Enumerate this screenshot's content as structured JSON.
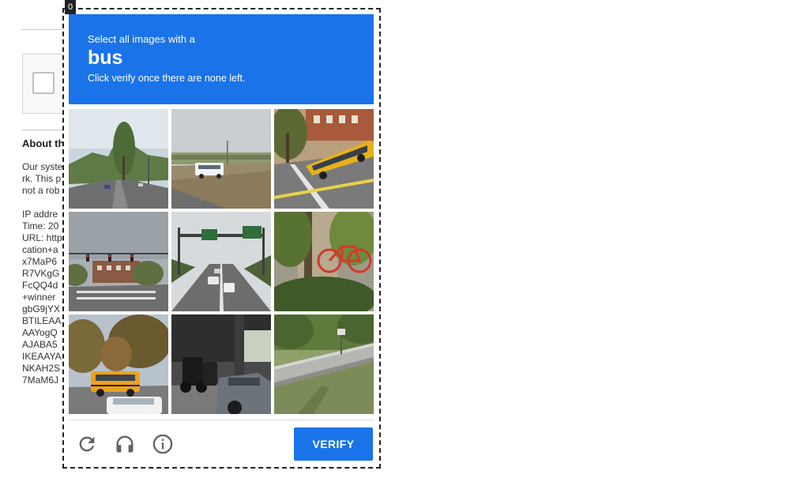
{
  "background_page": {
    "about_heading": "About th",
    "paragraph_lines": [
      "Our syste",
      "rk. This p",
      "not a rob"
    ],
    "details_lines": [
      "IP addre",
      "Time: 20",
      "URL: http",
      "cation+a",
      "x7MaP6",
      "R7VKgG",
      "FcQQ4d",
      "+winner",
      "gbG9jYX",
      "BTILEAA",
      "AAYogQ",
      "AJABA5",
      "IKEAAYA",
      "NKAH2S",
      "7MaM6J"
    ]
  },
  "challenge": {
    "corner_tag": "0",
    "instruction_line1": "Select all images with a",
    "target_object": "bus",
    "instruction_line3": "Click verify once there are none left.",
    "tiles": [
      {
        "scene": "street-with-trees"
      },
      {
        "scene": "white-shuttle-bus-roadside"
      },
      {
        "scene": "yellow-school-bus-intersection"
      },
      {
        "scene": "intersection-traffic-lights"
      },
      {
        "scene": "highway-overhead-sign"
      },
      {
        "scene": "bicycle-in-bushes"
      },
      {
        "scene": "yellow-school-bus-parked"
      },
      {
        "scene": "scooters-and-car"
      },
      {
        "scene": "bridge-over-grass"
      }
    ],
    "footer": {
      "reload_icon": "reload-icon",
      "audio_icon": "headphones-icon",
      "info_icon": "info-icon",
      "verify_label": "VERIFY"
    },
    "colors": {
      "accent": "#1a73e8"
    }
  }
}
